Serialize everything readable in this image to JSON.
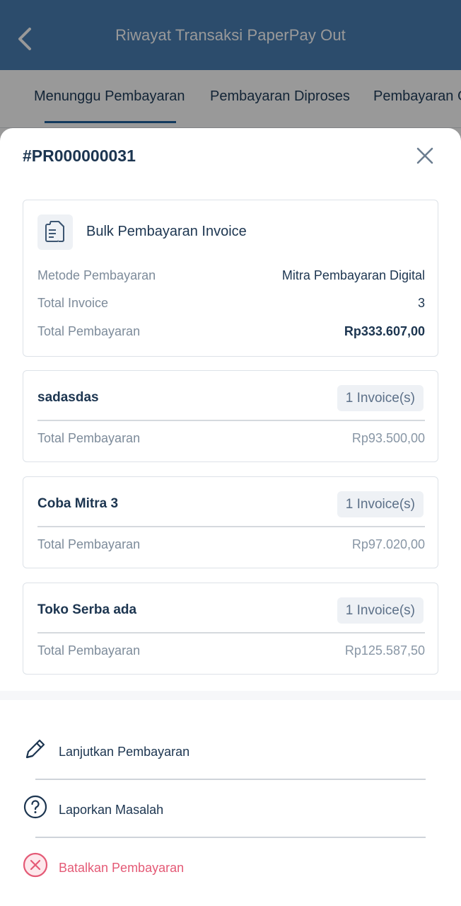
{
  "appbar": {
    "title": "Riwayat Transaksi PaperPay Out",
    "back_icon": "chevron-left-icon"
  },
  "tabs": [
    {
      "label": "Menunggu Pembayaran",
      "active": true
    },
    {
      "label": "Pembayaran Diproses",
      "active": false
    },
    {
      "label": "Pembayaran G",
      "active": false
    }
  ],
  "sheet": {
    "title": "#PR000000031",
    "summary": {
      "icon": "document-icon",
      "title": "Bulk Pembayaran Invoice",
      "rows": [
        {
          "label": "Metode Pembayaran",
          "value": "Mitra Pembayaran Digital"
        },
        {
          "label": "Total Invoice",
          "value": "3"
        },
        {
          "label": "Total Pembayaran",
          "value": "Rp333.607,00"
        }
      ]
    },
    "merchants": [
      {
        "name": "sadasdas",
        "badge": "1 Invoice(s)",
        "total_label": "Total Pembayaran",
        "total": "Rp93.500,00"
      },
      {
        "name": "Coba Mitra 3",
        "badge": "1 Invoice(s)",
        "total_label": "Total Pembayaran",
        "total": "Rp97.020,00"
      },
      {
        "name": "Toko Serba ada",
        "badge": "1 Invoice(s)",
        "total_label": "Total Pembayaran",
        "total": "Rp125.587,50"
      }
    ],
    "actions": [
      {
        "label": "Lanjutkan Pembayaran",
        "icon": "pencil-icon"
      },
      {
        "label": "Laporkan Masalah",
        "icon": "help-circle-icon"
      },
      {
        "label": "Batalkan Pembayaran",
        "icon": "cancel-circle-icon",
        "color": "#e45a76"
      }
    ]
  },
  "colors": {
    "appbar": "#4a7fb5",
    "accent": "#1f5f9c",
    "danger": "#e45a76",
    "text": "#1c3550"
  }
}
